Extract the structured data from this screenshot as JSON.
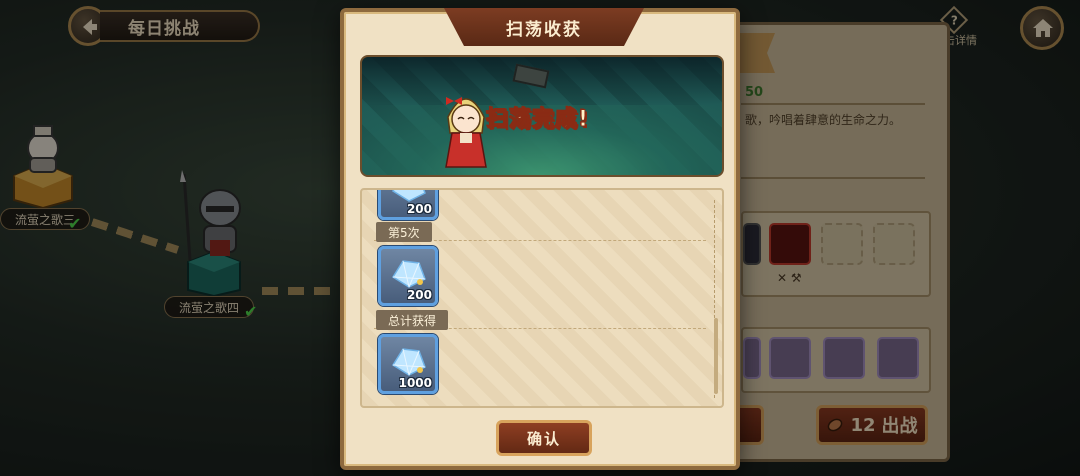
{
  "top_bar": {
    "title": "每日挑战"
  },
  "map": {
    "nodes": [
      {
        "label": "流萤之歌三",
        "cleared": true
      },
      {
        "label": "流萤之歌四",
        "cleared": true
      }
    ]
  },
  "side_panel": {
    "info_label": "击详情",
    "energy_fragment": "50",
    "description_fragment": "歌，吟唱着肆意的生命之力。",
    "fight_button": {
      "count": "12",
      "label": "出战"
    }
  },
  "modal": {
    "header": "扫荡收获",
    "banner_text": "扫荡完成!",
    "rows": [
      {
        "type": "reward",
        "amount": "200",
        "item": "blue-crystal"
      },
      {
        "type": "tag",
        "label": "第5次"
      },
      {
        "type": "reward",
        "amount": "200",
        "item": "blue-crystal"
      },
      {
        "type": "tag",
        "label": "总计获得"
      },
      {
        "type": "reward",
        "amount": "1000",
        "item": "blue-crystal"
      }
    ],
    "confirm_label": "确认"
  },
  "colors": {
    "modal_bg": "#f0e1c4",
    "header_bg": "#7c3c22",
    "accent_gold": "#d8a35c",
    "reward_border": "#5fa0e0",
    "check_green": "#4fd84b"
  }
}
